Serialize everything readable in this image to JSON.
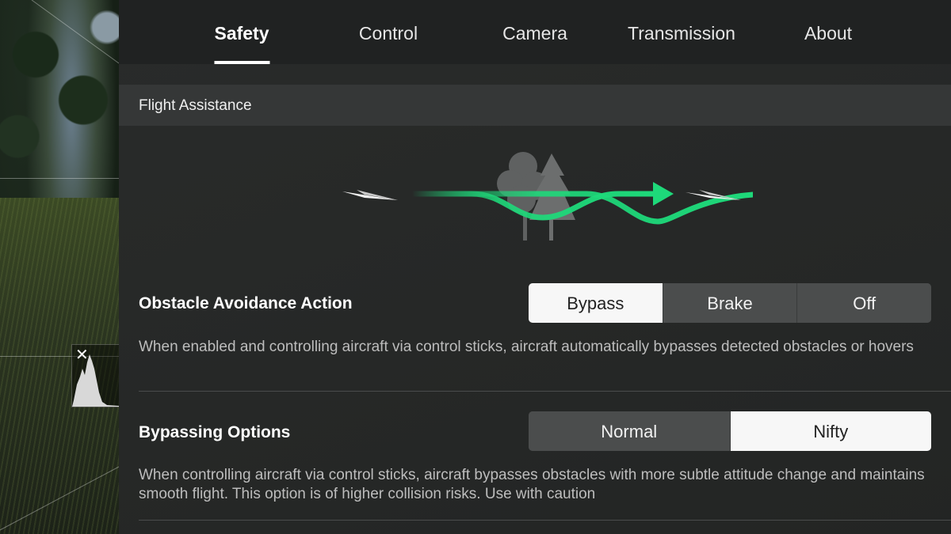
{
  "tabs": [
    {
      "label": "Safety",
      "active": true
    },
    {
      "label": "Control",
      "active": false
    },
    {
      "label": "Camera",
      "active": false
    },
    {
      "label": "Transmission",
      "active": false
    },
    {
      "label": "About",
      "active": false
    }
  ],
  "section": {
    "title": "Flight Assistance"
  },
  "illustration": {
    "path_color": "#1ed97a",
    "icons": [
      "paper-plane-icon",
      "trees-icon",
      "arrow-right-icon",
      "paper-plane-icon"
    ]
  },
  "obstacle_avoidance": {
    "title": "Obstacle Avoidance Action",
    "options": [
      "Bypass",
      "Brake",
      "Off"
    ],
    "selected": "Bypass",
    "description": "When enabled and controlling aircraft via control sticks, aircraft automatically bypasses detected obstacles or hovers"
  },
  "bypassing_options": {
    "title": "Bypassing Options",
    "options": [
      "Normal",
      "Nifty"
    ],
    "selected": "Nifty",
    "description": "When controlling aircraft via control sticks, aircraft bypasses obstacles with more subtle attitude change and maintains smooth flight. This option is of higher collision risks. Use with caution"
  },
  "histogram": {
    "close_icon": "close-icon"
  }
}
